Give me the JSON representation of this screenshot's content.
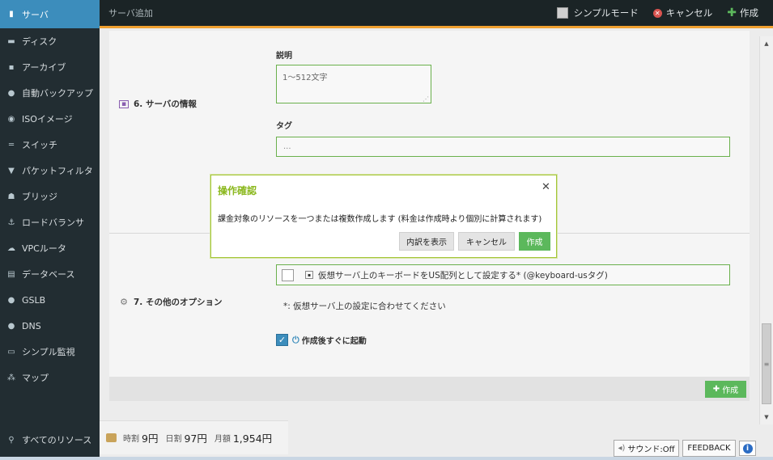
{
  "sidebar": {
    "items": [
      {
        "label": "サーバ",
        "icon": "server-icon",
        "glyph": "▮"
      },
      {
        "label": "ディスク",
        "icon": "disk-icon",
        "glyph": "▬"
      },
      {
        "label": "アーカイブ",
        "icon": "archive-icon",
        "glyph": "▪"
      },
      {
        "label": "自動バックアップ",
        "icon": "backup-icon",
        "glyph": "●"
      },
      {
        "label": "ISOイメージ",
        "icon": "disc-icon",
        "glyph": "◉"
      },
      {
        "label": "スイッチ",
        "icon": "switch-icon",
        "glyph": "═"
      },
      {
        "label": "パケットフィルタ",
        "icon": "filter-icon",
        "glyph": "▼"
      },
      {
        "label": "ブリッジ",
        "icon": "bridge-icon",
        "glyph": "☗"
      },
      {
        "label": "ロードバランサ",
        "icon": "loadbalancer-icon",
        "glyph": "⚓"
      },
      {
        "label": "VPCルータ",
        "icon": "router-icon",
        "glyph": "☁"
      },
      {
        "label": "データベース",
        "icon": "database-icon",
        "glyph": "▤"
      },
      {
        "label": "GSLB",
        "icon": "gslb-icon",
        "glyph": "●"
      },
      {
        "label": "DNS",
        "icon": "dns-icon",
        "glyph": "●"
      },
      {
        "label": "シンプル監視",
        "icon": "monitor-icon",
        "glyph": "▭"
      },
      {
        "label": "マップ",
        "icon": "map-icon",
        "glyph": "⁂"
      }
    ],
    "all_resources": "すべてのリソース"
  },
  "topbar": {
    "title": "サーバ追加",
    "simple_mode": "シンプルモード",
    "cancel": "キャンセル",
    "create": "作成"
  },
  "form": {
    "section6_label": "6. サーバの情報",
    "description_label": "説明",
    "description_placeholder": "1～512文字",
    "tag_label": "タグ",
    "tag_placeholder": "...",
    "section7_label": "7. その他のオプション",
    "keyboard_option": "仮想サーバ上のキーボードをUS配列として設定する* (@keyboard-usタグ)",
    "keyboard_note": "*: 仮想サーバ上の設定に合わせてください",
    "boot_option": "作成後すぐに起動",
    "create_button": "作成"
  },
  "price": {
    "hourly_label": "時割",
    "hourly_value": "9円",
    "daily_label": "日割",
    "daily_value": "97円",
    "monthly_label": "月額",
    "monthly_value": "1,954円"
  },
  "bottom": {
    "sound": "サウンド:Off",
    "feedback": "FEEDBACK"
  },
  "modal": {
    "title": "操作確認",
    "message": "課金対象のリソースを一つまたは複数作成します (料金は作成時より個別に計算されます)",
    "details_button": "内訳を表示",
    "cancel_button": "キャンセル",
    "create_button": "作成"
  },
  "colors": {
    "sidebar_bg": "#222d32",
    "sidebar_active": "#3c8dbc",
    "accent_green": "#5cb85c",
    "modal_title": "#8bb81e",
    "topbar_border": "#f0a030"
  }
}
